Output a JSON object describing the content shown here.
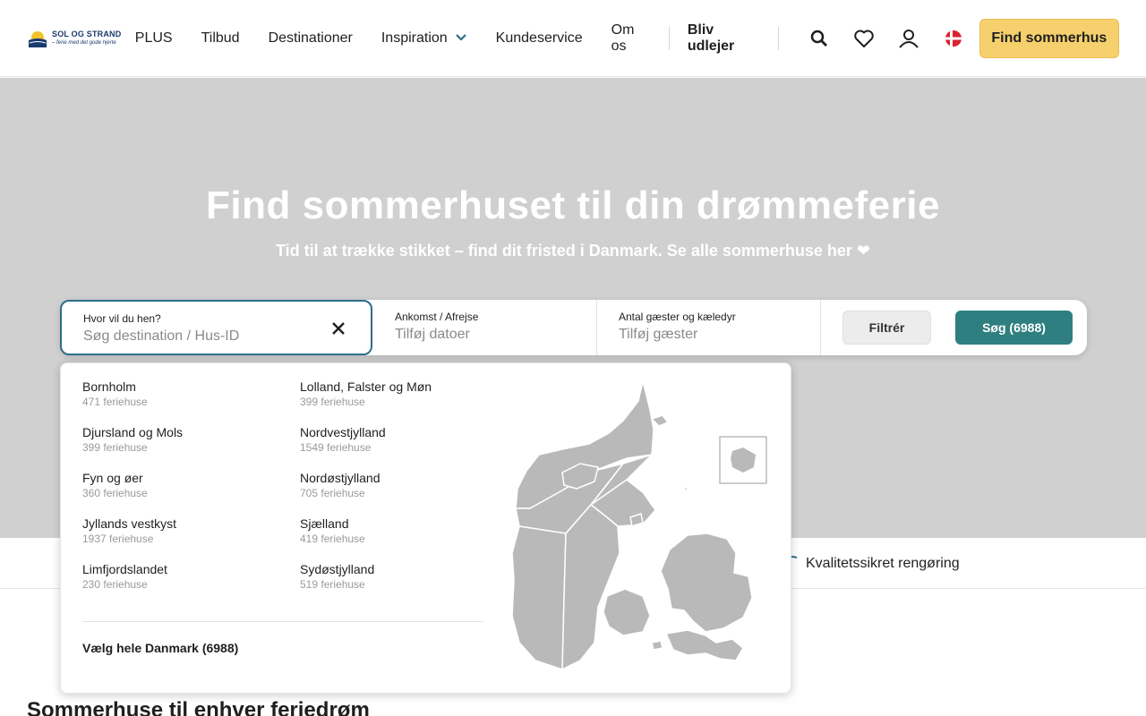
{
  "header": {
    "logo": {
      "name": "SOL OG STRAND",
      "tagline": "– ferie med det gode hjerte"
    },
    "nav": [
      {
        "label": "PLUS"
      },
      {
        "label": "Tilbud"
      },
      {
        "label": "Destinationer"
      },
      {
        "label": "Inspiration"
      },
      {
        "label": "Kundeservice"
      },
      {
        "label": "Om os"
      }
    ],
    "owner_link": "Bliv udlejer",
    "icons": [
      "search-icon",
      "heart-icon",
      "user-icon",
      "danish-flag-icon"
    ],
    "cta": "Find sommerhus"
  },
  "hero": {
    "title": "Find sommerhuset til din drømmeferie",
    "subtitle": "Tid til at trække stikket – find dit fristed i Danmark. Se alle sommerhuse her ❤"
  },
  "search": {
    "destination": {
      "label": "Hvor vil du hen?",
      "placeholder": "Søg destination / Hus-ID"
    },
    "dates": {
      "label": "Ankomst / Afrejse",
      "placeholder": "Tilføj datoer"
    },
    "guests": {
      "label": "Antal gæster og kæledyr",
      "placeholder": "Tilføj gæster"
    },
    "filter_label": "Filtrér",
    "search_label": "Søg (6988)"
  },
  "dropdown": {
    "regions_left": [
      {
        "name": "Bornholm",
        "count": "471 feriehuse"
      },
      {
        "name": "Djursland og Mols",
        "count": "399 feriehuse"
      },
      {
        "name": "Fyn og øer",
        "count": "360 feriehuse"
      },
      {
        "name": "Jyllands vestkyst",
        "count": "1937 feriehuse"
      },
      {
        "name": "Limfjordslandet",
        "count": "230 feriehuse"
      }
    ],
    "regions_right": [
      {
        "name": "Lolland, Falster og Møn",
        "count": "399 feriehuse"
      },
      {
        "name": "Nordvestjylland",
        "count": "1549 feriehuse"
      },
      {
        "name": "Nordøstjylland",
        "count": "705 feriehuse"
      },
      {
        "name": "Sjælland",
        "count": "419 feriehuse"
      },
      {
        "name": "Sydøstjylland",
        "count": "519 feriehuse"
      }
    ],
    "select_all": "Vælg hele Danmark (6988)"
  },
  "benefits": {
    "item": "Kvalitetssikret rengøring"
  },
  "section": {
    "title": "Sommerhuse til enhver feriedrøm"
  },
  "colors": {
    "accent_yellow": "#f6d06d",
    "teal": "#2f7f80",
    "focus_border": "#2f6d8a",
    "hero_bg": "#d0d0d0"
  }
}
